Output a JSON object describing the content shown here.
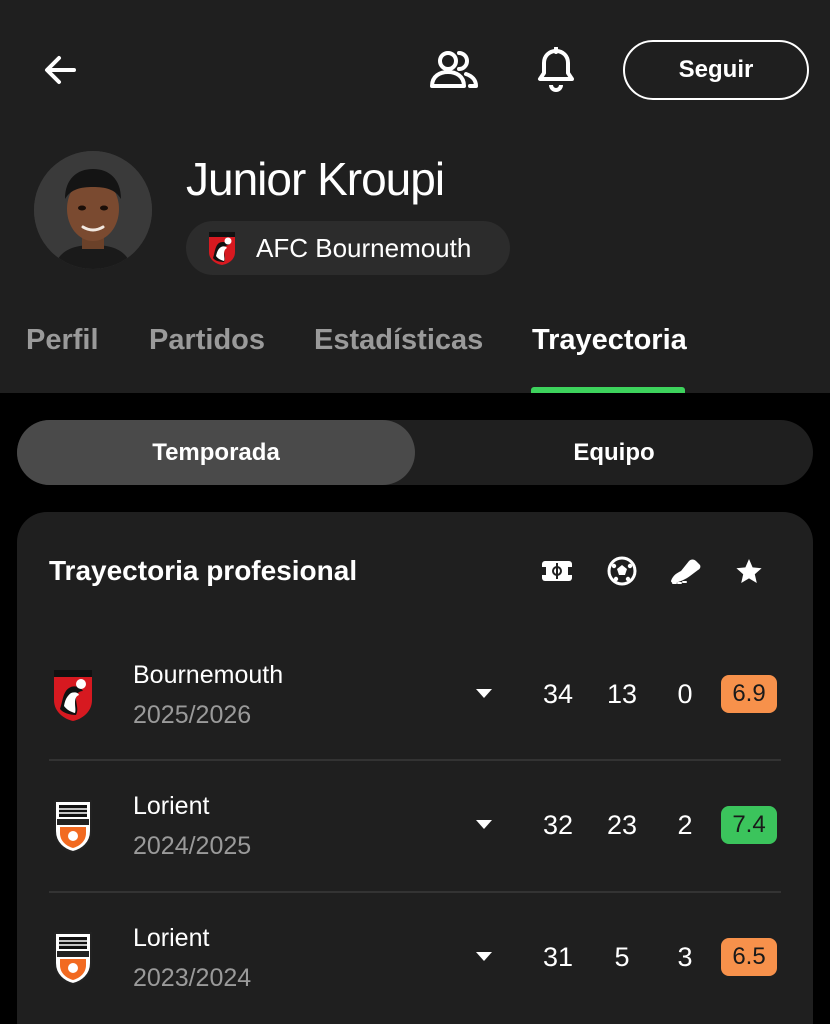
{
  "header": {
    "follow_label": "Seguir",
    "player_name": "Junior Kroupi",
    "team_name": "AFC Bournemouth",
    "icons": [
      "back-arrow-icon",
      "people-icon",
      "bell-icon"
    ]
  },
  "tabs": [
    {
      "label": "Perfil",
      "active": false
    },
    {
      "label": "Partidos",
      "active": false
    },
    {
      "label": "Estadísticas",
      "active": false
    },
    {
      "label": "Trayectoria",
      "active": true
    }
  ],
  "segment": {
    "left": "Temporada",
    "right": "Equipo",
    "selected": "Temporada"
  },
  "career": {
    "title": "Trayectoria profesional",
    "columns": [
      "appearances-icon",
      "goals-icon",
      "assists-icon",
      "rating-icon"
    ],
    "rows": [
      {
        "club": "Bournemouth",
        "season": "2025/2026",
        "apps": "34",
        "goals": "13",
        "assists": "0",
        "rating": "6.9",
        "rating_color": "#f7914b"
      },
      {
        "club": "Lorient",
        "season": "2024/2025",
        "apps": "32",
        "goals": "23",
        "assists": "2",
        "rating": "7.4",
        "rating_color": "#3bc45c"
      },
      {
        "club": "Lorient",
        "season": "2023/2024",
        "apps": "31",
        "goals": "5",
        "assists": "3",
        "rating": "6.5",
        "rating_color": "#f7914b"
      }
    ]
  },
  "colors": {
    "accent_green": "#3dd25c",
    "rating_orange": "#f7914b",
    "rating_green": "#3bc45c"
  }
}
